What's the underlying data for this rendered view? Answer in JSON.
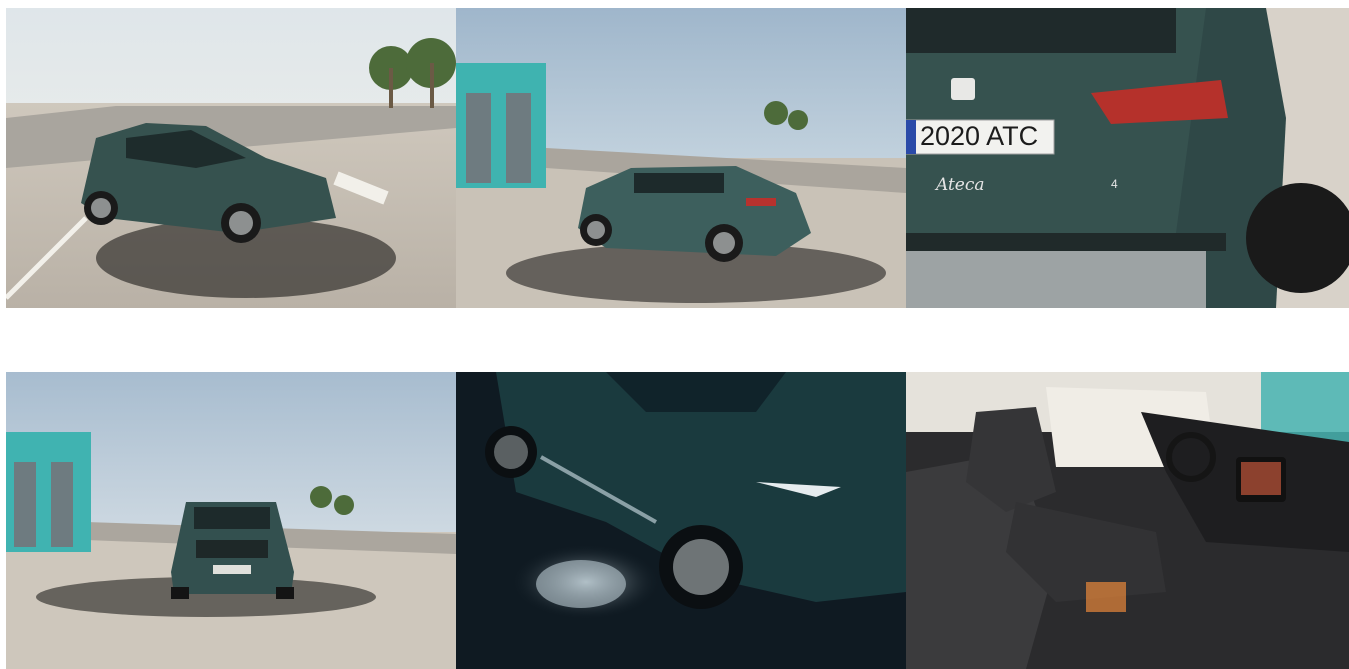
{
  "gallery": {
    "photos": [
      {
        "subject": "SUV three-quarter front view on rooftop parking with palm trees",
        "theme_color": "#3b5a58"
      },
      {
        "subject": "SUV rear three-quarter view beside teal building",
        "theme_color": "#3d5f5d"
      },
      {
        "subject": "Rear close-up with license plate and badge",
        "theme_color": "#2f4a49",
        "plate_text": "2020 ATC",
        "model_script": "Ateca",
        "trim_mark": "4"
      },
      {
        "subject": "SUV front view on rooftop with building and palms",
        "theme_color": "#33504f"
      },
      {
        "subject": "Night side detail with puddle light logo projection",
        "theme_color": "#0f1a22"
      },
      {
        "subject": "Interior dashboard and front seats",
        "theme_color": "#2a2a2c"
      }
    ]
  }
}
